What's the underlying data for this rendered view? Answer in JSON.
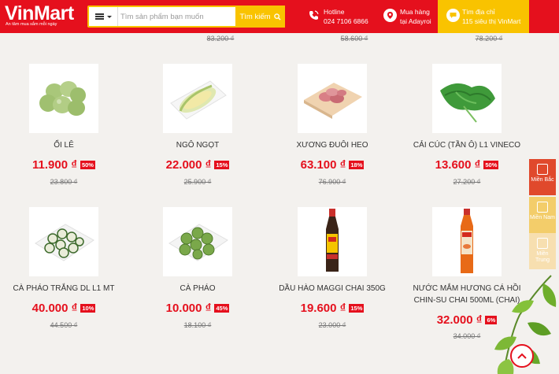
{
  "header": {
    "logo": "VinMart",
    "tagline": "An tâm mua sắm mỗi ngày",
    "search_placeholder": "Tìm sản phẩm bạn muốn",
    "search_button": "Tìm kiếm",
    "hotline_label": "Hotline",
    "hotline_number": "024 7106 6866",
    "adayroi_line1": "Mua hàng",
    "adayroi_line2": "tại Adayroi",
    "store_line1": "Tìm địa chỉ",
    "store_line2": "115 siêu thị VinMart",
    "colors": {
      "brand": "#e5101d",
      "accent": "#f9c300"
    }
  },
  "top_row_old_prices": [
    "83.200 ₫",
    "58.600 ₫",
    "78.200 ₫"
  ],
  "products_row1": [
    {
      "name": "ỔI LÊ",
      "price": "11.900 ₫",
      "discount": "50%",
      "old_price": "23.800 ₫"
    },
    {
      "name": "NGÔ NGỌT",
      "price": "22.000 ₫",
      "discount": "15%",
      "old_price": "25.900 ₫"
    },
    {
      "name": "XƯƠNG ĐUÔI HEO",
      "price": "63.100 ₫",
      "discount": "18%",
      "old_price": "76.900 ₫"
    },
    {
      "name": "CẢI CÚC (TẦN Ô) L1 VINECO",
      "price": "13.600 ₫",
      "discount": "50%",
      "old_price": "27.200 ₫"
    }
  ],
  "products_row2": [
    {
      "name": "CÀ PHÁO TRẮNG DL L1 MT",
      "price": "40.000 ₫",
      "discount": "10%",
      "old_price": "44.500 ₫"
    },
    {
      "name": "CÀ PHÁO",
      "price": "10.000 ₫",
      "discount": "45%",
      "old_price": "18.100 ₫"
    },
    {
      "name": "DẦU HÀO MAGGI CHAI 350G",
      "price": "19.600 ₫",
      "discount": "15%",
      "old_price": "23.000 ₫"
    },
    {
      "name": "NƯỚC MẮM HƯƠNG CÁ HỒI CHIN-SU CHAI 500ML (CHAI)",
      "price": "32.000 ₫",
      "discount": "6%",
      "old_price": "34.000 ₫"
    }
  ],
  "regions": [
    "Miền Bắc",
    "Miền Nam",
    "Miền Trung"
  ]
}
